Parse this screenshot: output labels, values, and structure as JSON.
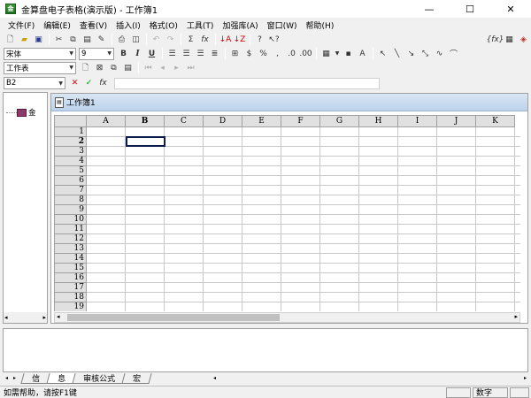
{
  "window": {
    "title": "金算盘电子表格(演示版) - 工作簿1",
    "app_icon_text": "金",
    "minimize_glyph": "—",
    "maximize_glyph": "☐",
    "close_glyph": "✕"
  },
  "menu": [
    "文件(F)",
    "编辑(E)",
    "查看(V)",
    "插入(I)",
    "格式(O)",
    "工具(T)",
    "加强库(A)",
    "窗口(W)",
    "帮助(H)"
  ],
  "toolbar1": {
    "icons": [
      "new-icon",
      "open-icon",
      "save-icon",
      "cut-icon",
      "copy-icon",
      "paste-icon",
      "format-painter-icon",
      "print-icon",
      "print-preview-icon",
      "undo-icon",
      "redo-icon",
      "sum-icon",
      "function-icon",
      "sort-ascending-icon",
      "sort-descending-icon",
      "help-icon",
      "whats-this-icon"
    ],
    "right_icons": [
      "formula-toggle-icon",
      "grid-toggle-icon",
      "chart-icon"
    ]
  },
  "toolbar2": {
    "font_name": "宋体",
    "font_size": "9",
    "bold": "B",
    "italic": "I",
    "underline": "U"
  },
  "toolbar3": {
    "sheet_selector": "工作表"
  },
  "formula_bar": {
    "cell_ref": "B2",
    "cancel_glyph": "✕",
    "confirm_glyph": "✓",
    "fx_glyph": "fx",
    "formula_value": ""
  },
  "left_tree": {
    "root_label": "金"
  },
  "document": {
    "title": "工作簿1",
    "columns": [
      "A",
      "B",
      "C",
      "D",
      "E",
      "F",
      "G",
      "H",
      "I",
      "J",
      "K"
    ],
    "rows": [
      "1",
      "2",
      "3",
      "4",
      "5",
      "6",
      "7",
      "8",
      "9",
      "10",
      "11",
      "12",
      "13",
      "14",
      "15",
      "16",
      "17",
      "18",
      "19"
    ],
    "selected_col": "B",
    "selected_row": "2"
  },
  "sheet_tabs": [
    "信",
    "息",
    "审核公式",
    "宏"
  ],
  "status": {
    "message": "如需帮助，请按F1键",
    "numlock": "数字"
  }
}
